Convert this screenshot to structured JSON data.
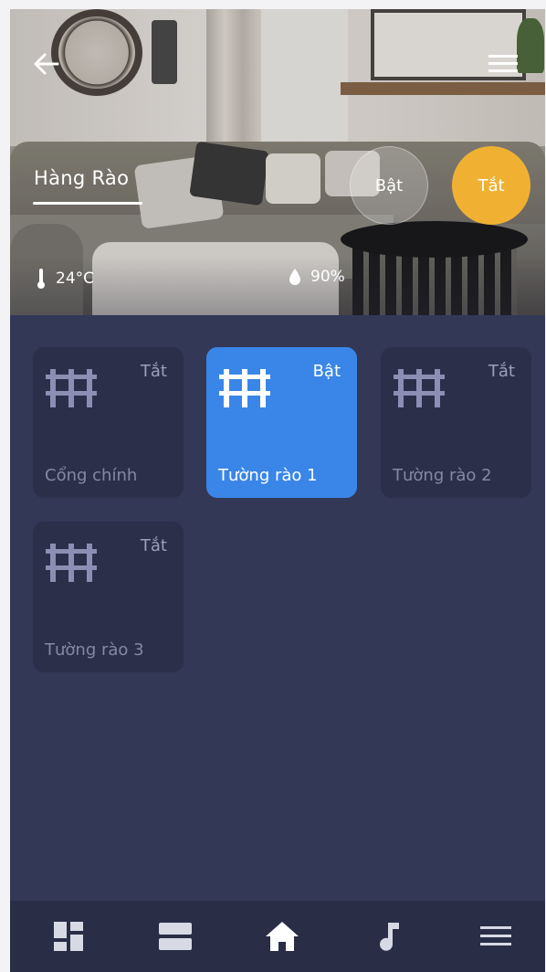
{
  "room": {
    "title": "Hàng Rào",
    "toggle_on_label": "Bật",
    "toggle_off_label": "Tắt",
    "selected_toggle": "off"
  },
  "stats": {
    "temperature": "24°C",
    "humidity": "90%"
  },
  "devices": [
    {
      "name": "Cổng chính",
      "state": "Tắt",
      "active": false,
      "icon": "fence-icon"
    },
    {
      "name": "Tường rào 1",
      "state": "Bật",
      "active": true,
      "icon": "fence-icon"
    },
    {
      "name": "Tường rào 2",
      "state": "Tắt",
      "active": false,
      "icon": "fence-icon"
    },
    {
      "name": "Tường rào 3",
      "state": "Tắt",
      "active": false,
      "icon": "fence-icon"
    }
  ],
  "bottom_nav": [
    {
      "icon": "dashboard-grid-icon"
    },
    {
      "icon": "rooms-icon"
    },
    {
      "icon": "home-icon",
      "active": true
    },
    {
      "icon": "music-note-icon"
    },
    {
      "icon": "menu-icon"
    }
  ],
  "colors": {
    "background": "#343857",
    "card": "#2b2f4a",
    "card_active": "#3a86e8",
    "toggle_off": "#f0b133",
    "nav": "#292d46"
  }
}
